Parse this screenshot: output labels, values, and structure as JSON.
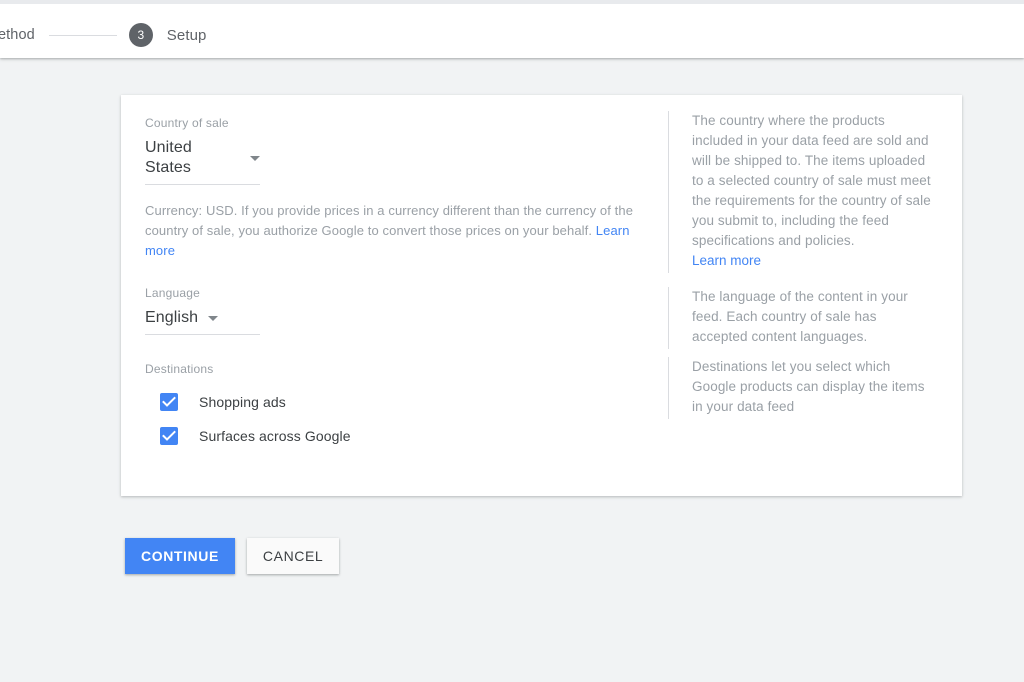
{
  "stepper": {
    "previous_step_label": "ethod",
    "current_step_number": "3",
    "current_step_label": "Setup",
    "circle_color": "#5f6368"
  },
  "form": {
    "country": {
      "label": "Country of sale",
      "value": "United States",
      "caret_icon": "chevron-down-icon",
      "note_text": "Currency: USD. If you provide prices in a currency different than the currency of the country of sale, you authorize Google to convert those prices on your behalf. ",
      "note_link": "Learn more"
    },
    "language": {
      "label": "Language",
      "value": "English",
      "caret_icon": "chevron-down-icon"
    },
    "destinations": {
      "label": "Destinations",
      "options": [
        {
          "label": "Shopping ads",
          "checked": true
        },
        {
          "label": "Surfaces across Google",
          "checked": true
        }
      ],
      "checkbox_color": "#4285f4"
    }
  },
  "help": {
    "country": {
      "text": "The country where the products included in your data feed are sold and will be shipped to. The items uploaded to a selected country of sale must meet the requirements for the country of sale you submit to, including the feed specifications and policies.",
      "link": "Learn more"
    },
    "language": {
      "text": "The language of the content in your feed. Each country of sale has accepted content languages."
    },
    "destinations": {
      "text": "Destinations let you select which Google products can display the items in your data feed"
    }
  },
  "actions": {
    "continue_label": "CONTINUE",
    "cancel_label": "CANCEL",
    "primary_color": "#4285f4"
  },
  "colors": {
    "page_background": "#f1f3f4",
    "card_background": "#ffffff",
    "muted_text": "#9aa0a6",
    "body_text": "#3c4043",
    "link": "#4285f4",
    "divider": "#dadce0"
  }
}
